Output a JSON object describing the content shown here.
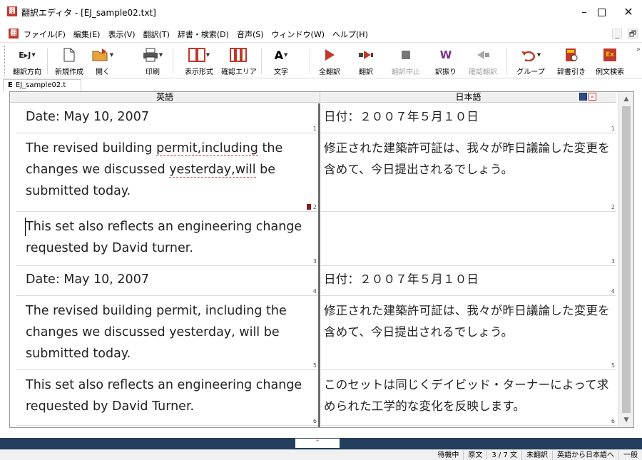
{
  "window": {
    "app_icon": "翻",
    "title": "翻訳エディタ - [EJ_sample02.txt]",
    "min": "–",
    "close": "✕"
  },
  "menu": {
    "doc_icon": "翻",
    "items": [
      "ファイル(F)",
      "編集(E)",
      "表示(V)",
      "翻訳(T)",
      "辞書・検索(D)",
      "音声(S)",
      "ウィンドウ(W)",
      "ヘルプ(H)"
    ],
    "mdi_min": "_",
    "mdi_restore": "🗗"
  },
  "toolbar": {
    "direction_icon": "E▸J",
    "direction": "翻訳方向",
    "new": "新規作成",
    "open": "開く",
    "print": "印刷",
    "display_format": "表示形式",
    "confirm_area": "確認エリア",
    "font_icon": "A",
    "font": "文字",
    "translate_all": "全翻訳",
    "translate": "翻訳",
    "stop": "翻訳中止",
    "furigana_icon": "W",
    "furigana": "訳振り",
    "confirm_translate": "確認翻訳",
    "group": "グループ",
    "dictionary": "辞書引き",
    "example_icon": "Ex",
    "example_search": "例文検索",
    "more_arrow": "»"
  },
  "doc_tab": {
    "marker": "E",
    "label": "EJ_sample02.t"
  },
  "editor": {
    "head_en": "英語",
    "head_ja": "日本語",
    "scroll_up": "▲",
    "scroll_down": "▼",
    "segments": [
      {
        "num": "1",
        "en": "Date: May 10, 2007",
        "ja": "日付：２００７年５月１０日"
      },
      {
        "num": "2",
        "en_pre": "The revised building ",
        "en_err1": "permit,including",
        "en_mid": " the changes we discussed ",
        "en_err2": "yesterday,will",
        "en_post": " be submitted today.",
        "ja": "修正された建築許可証は、我々が昨日議論した変更を含めて、今日提出されるでしょう。",
        "flagged": true
      },
      {
        "num": "3",
        "en": "This set also reflects an engineering change requested by David turner.",
        "ja": ""
      },
      {
        "num": "4",
        "en": "Date: May 10, 2007",
        "ja": "日付：２００７年５月１０日"
      },
      {
        "num": "5",
        "en": "The revised building permit, including the changes we discussed yesterday, will be submitted today.",
        "ja": "修正された建築許可証は、我々が昨日議論した変更を含めて、今日提出されるでしょう。"
      },
      {
        "num": "6",
        "en": "This set also reflects an engineering change requested by David Turner.",
        "ja": "このセットは同じくデイビッド・ターナーによって求められた工学的な変化を反映します。"
      }
    ]
  },
  "splitter": {
    "knob": "⌃"
  },
  "status": {
    "items": [
      "待機中",
      "原文",
      "3 / 7 文",
      "未翻訳",
      "英語から日本語へ",
      "一般"
    ]
  }
}
